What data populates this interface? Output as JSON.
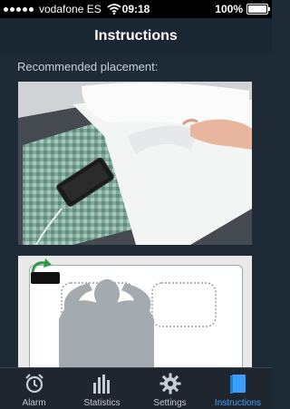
{
  "status": {
    "carrier": "vodafone ES",
    "time": "09:18",
    "battery": "100%"
  },
  "header": {
    "title": "Instructions"
  },
  "main": {
    "section_label": "Recommended placement:"
  },
  "tabs": [
    {
      "label": "Alarm",
      "icon": "alarm-clock-icon",
      "active": false
    },
    {
      "label": "Statistics",
      "icon": "bar-chart-icon",
      "active": false
    },
    {
      "label": "Settings",
      "icon": "gear-icon",
      "active": false
    },
    {
      "label": "Instructions",
      "icon": "book-icon",
      "active": true
    }
  ],
  "colors": {
    "accent": "#3aa0ff",
    "background": "#1f2a37"
  }
}
